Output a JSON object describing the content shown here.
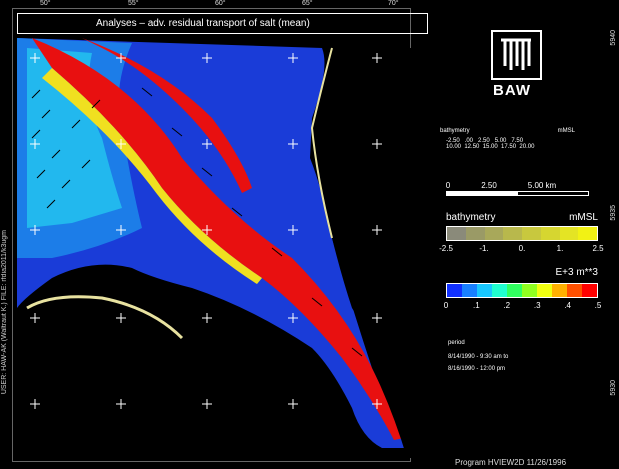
{
  "title": "Analyses – adv. residual transport of salt (mean)",
  "top_ticks": [
    "50°",
    "55°",
    "60°",
    "65°",
    "70°"
  ],
  "right_ticks": [
    "5940",
    "5935",
    "5930"
  ],
  "side_label": "USER: HAW-AK (Waltraut K.)  FILE: rfdia2011/k3ugm",
  "logo_text": "BAW",
  "bathy_table": {
    "header_left": "bathymetry",
    "header_right": "mMSL",
    "row1": "-2.50   .00   2.50   5.00   7.50",
    "row2": "10.00  12.50  15.00  17.50  20.00"
  },
  "scale": {
    "labels": [
      "0",
      "2.50",
      "5.00 km"
    ]
  },
  "bathy_legend": {
    "title": "bathymetry",
    "unit": "mMSL",
    "colors": [
      "#8a8a7a",
      "#9a9a66",
      "#a8a85a",
      "#b8b84c",
      "#c8c83e",
      "#d6d630",
      "#e4e424",
      "#f2f214"
    ],
    "ticks": [
      "-2.5",
      "-1.",
      "0.",
      "1.",
      "2.5"
    ]
  },
  "transport_legend": {
    "title": "E+3 m**3",
    "colors": [
      "#1030ff",
      "#1880ff",
      "#18c8ff",
      "#20ffd0",
      "#30ff60",
      "#90ff20",
      "#f0ff10",
      "#ffb000",
      "#ff5000",
      "#ff0000"
    ],
    "ticks": [
      "0",
      ".1",
      ".2",
      ".3",
      ".4",
      ".5"
    ]
  },
  "period": {
    "label": "period",
    "start": "8/14/1990 - 9:30 am to",
    "end": "8/16/1990 - 12:00 pm"
  },
  "footer": "Program  HVIEW2D     11/26/1996"
}
